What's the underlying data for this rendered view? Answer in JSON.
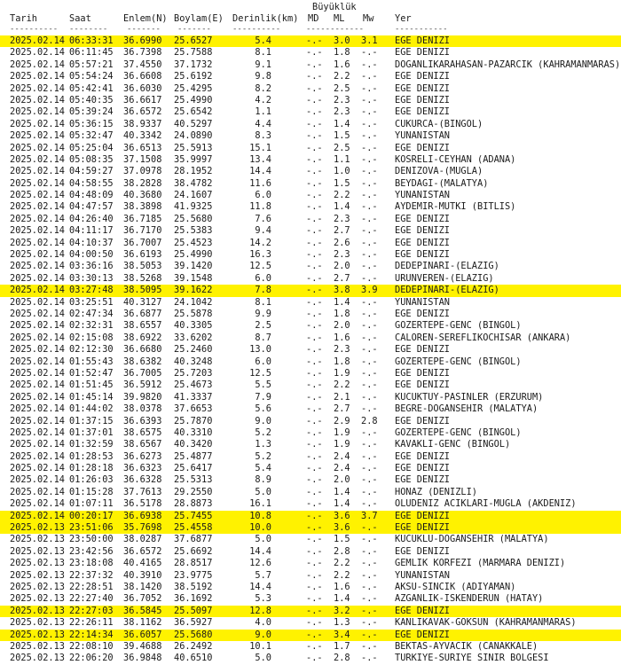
{
  "header": {
    "group_label": "Büyüklük",
    "columns": {
      "tarih": "Tarih",
      "saat": "Saat",
      "enlem": "Enlem(N)",
      "boylam": "Boylam(E)",
      "derinlik": "Derinlik(km)",
      "md": "MD",
      "ml": "ML",
      "mw": "Mw",
      "yer": "Yer"
    },
    "dashes": {
      "tarih": "----------",
      "saat": "--------",
      "enlem": "-------",
      "boylam": "-------",
      "derinlik": "----------",
      "mag": "------------",
      "yer": "-----------"
    }
  },
  "rows": [
    {
      "tarih": "2025.02.14",
      "saat": "06:33:31",
      "enlem": "36.6990",
      "boylam": "25.6527",
      "derinlik": "5.4",
      "md": "-.-",
      "ml": "3.0",
      "mw": "3.1",
      "yer": "EGE DENIZI",
      "hl": true
    },
    {
      "tarih": "2025.02.14",
      "saat": "06:11:45",
      "enlem": "36.7398",
      "boylam": "25.7588",
      "derinlik": "8.1",
      "md": "-.-",
      "ml": "1.8",
      "mw": "-.-",
      "yer": "EGE DENIZI",
      "hl": false
    },
    {
      "tarih": "2025.02.14",
      "saat": "05:57:21",
      "enlem": "37.4550",
      "boylam": "37.1732",
      "derinlik": "9.1",
      "md": "-.-",
      "ml": "1.6",
      "mw": "-.-",
      "yer": "DOGANLIKARAHASAN-PAZARCIK (KAHRAMANMARAS)",
      "hl": false
    },
    {
      "tarih": "2025.02.14",
      "saat": "05:54:24",
      "enlem": "36.6608",
      "boylam": "25.6192",
      "derinlik": "9.8",
      "md": "-.-",
      "ml": "2.2",
      "mw": "-.-",
      "yer": "EGE DENIZI",
      "hl": false
    },
    {
      "tarih": "2025.02.14",
      "saat": "05:42:41",
      "enlem": "36.6030",
      "boylam": "25.4295",
      "derinlik": "8.2",
      "md": "-.-",
      "ml": "2.5",
      "mw": "-.-",
      "yer": "EGE DENIZI",
      "hl": false
    },
    {
      "tarih": "2025.02.14",
      "saat": "05:40:35",
      "enlem": "36.6617",
      "boylam": "25.4990",
      "derinlik": "4.2",
      "md": "-.-",
      "ml": "2.3",
      "mw": "-.-",
      "yer": "EGE DENIZI",
      "hl": false
    },
    {
      "tarih": "2025.02.14",
      "saat": "05:39:24",
      "enlem": "36.6572",
      "boylam": "25.6542",
      "derinlik": "1.1",
      "md": "-.-",
      "ml": "2.3",
      "mw": "-.-",
      "yer": "EGE DENIZI",
      "hl": false
    },
    {
      "tarih": "2025.02.14",
      "saat": "05:36:15",
      "enlem": "38.9337",
      "boylam": "40.5297",
      "derinlik": "4.4",
      "md": "-.-",
      "ml": "1.4",
      "mw": "-.-",
      "yer": "CUKURCA-(BINGOL)",
      "hl": false
    },
    {
      "tarih": "2025.02.14",
      "saat": "05:32:47",
      "enlem": "40.3342",
      "boylam": "24.0890",
      "derinlik": "8.3",
      "md": "-.-",
      "ml": "1.5",
      "mw": "-.-",
      "yer": "YUNANISTAN",
      "hl": false
    },
    {
      "tarih": "2025.02.14",
      "saat": "05:25:04",
      "enlem": "36.6513",
      "boylam": "25.5913",
      "derinlik": "15.1",
      "md": "-.-",
      "ml": "2.5",
      "mw": "-.-",
      "yer": "EGE DENIZI",
      "hl": false
    },
    {
      "tarih": "2025.02.14",
      "saat": "05:08:35",
      "enlem": "37.1508",
      "boylam": "35.9997",
      "derinlik": "13.4",
      "md": "-.-",
      "ml": "1.1",
      "mw": "-.-",
      "yer": "KOSRELI-CEYHAN (ADANA)",
      "hl": false
    },
    {
      "tarih": "2025.02.14",
      "saat": "04:59:27",
      "enlem": "37.0978",
      "boylam": "28.1952",
      "derinlik": "14.4",
      "md": "-.-",
      "ml": "1.0",
      "mw": "-.-",
      "yer": "DENIZOVA-(MUGLA)",
      "hl": false
    },
    {
      "tarih": "2025.02.14",
      "saat": "04:58:55",
      "enlem": "38.2828",
      "boylam": "38.4782",
      "derinlik": "11.6",
      "md": "-.-",
      "ml": "1.5",
      "mw": "-.-",
      "yer": "BEYDAGI-(MALATYA)",
      "hl": false
    },
    {
      "tarih": "2025.02.14",
      "saat": "04:48:09",
      "enlem": "40.3680",
      "boylam": "24.1607",
      "derinlik": "6.0",
      "md": "-.-",
      "ml": "2.2",
      "mw": "-.-",
      "yer": "YUNANISTAN",
      "hl": false
    },
    {
      "tarih": "2025.02.14",
      "saat": "04:47:57",
      "enlem": "38.3898",
      "boylam": "41.9325",
      "derinlik": "11.8",
      "md": "-.-",
      "ml": "1.4",
      "mw": "-.-",
      "yer": "AYDEMIR-MUTKI (BITLIS)",
      "hl": false
    },
    {
      "tarih": "2025.02.14",
      "saat": "04:26:40",
      "enlem": "36.7185",
      "boylam": "25.5680",
      "derinlik": "7.6",
      "md": "-.-",
      "ml": "2.3",
      "mw": "-.-",
      "yer": "EGE DENIZI",
      "hl": false
    },
    {
      "tarih": "2025.02.14",
      "saat": "04:11:17",
      "enlem": "36.7170",
      "boylam": "25.5383",
      "derinlik": "9.4",
      "md": "-.-",
      "ml": "2.7",
      "mw": "-.-",
      "yer": "EGE DENIZI",
      "hl": false
    },
    {
      "tarih": "2025.02.14",
      "saat": "04:10:37",
      "enlem": "36.7007",
      "boylam": "25.4523",
      "derinlik": "14.2",
      "md": "-.-",
      "ml": "2.6",
      "mw": "-.-",
      "yer": "EGE DENIZI",
      "hl": false
    },
    {
      "tarih": "2025.02.14",
      "saat": "04:00:50",
      "enlem": "36.6193",
      "boylam": "25.4990",
      "derinlik": "16.3",
      "md": "-.-",
      "ml": "2.3",
      "mw": "-.-",
      "yer": "EGE DENIZI",
      "hl": false
    },
    {
      "tarih": "2025.02.14",
      "saat": "03:36:16",
      "enlem": "38.5053",
      "boylam": "39.1420",
      "derinlik": "12.5",
      "md": "-.-",
      "ml": "2.0",
      "mw": "-.-",
      "yer": "DEDEPINARI-(ELAZIG)",
      "hl": false
    },
    {
      "tarih": "2025.02.14",
      "saat": "03:30:13",
      "enlem": "38.5268",
      "boylam": "39.1548",
      "derinlik": "6.0",
      "md": "-.-",
      "ml": "2.7",
      "mw": "-.-",
      "yer": "URUNVEREN-(ELAZIG)",
      "hl": false
    },
    {
      "tarih": "2025.02.14",
      "saat": "03:27:48",
      "enlem": "38.5095",
      "boylam": "39.1622",
      "derinlik": "7.8",
      "md": "-.-",
      "ml": "3.8",
      "mw": "3.9",
      "yer": "DEDEPINARI-(ELAZIG)",
      "hl": true
    },
    {
      "tarih": "2025.02.14",
      "saat": "03:25:51",
      "enlem": "40.3127",
      "boylam": "24.1042",
      "derinlik": "8.1",
      "md": "-.-",
      "ml": "1.4",
      "mw": "-.-",
      "yer": "YUNANISTAN",
      "hl": false
    },
    {
      "tarih": "2025.02.14",
      "saat": "02:47:34",
      "enlem": "36.6877",
      "boylam": "25.5878",
      "derinlik": "9.9",
      "md": "-.-",
      "ml": "1.8",
      "mw": "-.-",
      "yer": "EGE DENIZI",
      "hl": false
    },
    {
      "tarih": "2025.02.14",
      "saat": "02:32:31",
      "enlem": "38.6557",
      "boylam": "40.3305",
      "derinlik": "2.5",
      "md": "-.-",
      "ml": "2.0",
      "mw": "-.-",
      "yer": "GOZERTEPE-GENC (BINGOL)",
      "hl": false
    },
    {
      "tarih": "2025.02.14",
      "saat": "02:15:08",
      "enlem": "38.6922",
      "boylam": "33.6202",
      "derinlik": "8.7",
      "md": "-.-",
      "ml": "1.6",
      "mw": "-.-",
      "yer": "CALOREN-SEREFLIKOCHISAR (ANKARA)",
      "hl": false
    },
    {
      "tarih": "2025.02.14",
      "saat": "02:12:30",
      "enlem": "36.6680",
      "boylam": "25.2460",
      "derinlik": "13.0",
      "md": "-.-",
      "ml": "2.3",
      "mw": "-.-",
      "yer": "EGE DENIZI",
      "hl": false
    },
    {
      "tarih": "2025.02.14",
      "saat": "01:55:43",
      "enlem": "38.6382",
      "boylam": "40.3248",
      "derinlik": "6.0",
      "md": "-.-",
      "ml": "1.8",
      "mw": "-.-",
      "yer": "GOZERTEPE-GENC (BINGOL)",
      "hl": false
    },
    {
      "tarih": "2025.02.14",
      "saat": "01:52:47",
      "enlem": "36.7005",
      "boylam": "25.7203",
      "derinlik": "12.5",
      "md": "-.-",
      "ml": "1.9",
      "mw": "-.-",
      "yer": "EGE DENIZI",
      "hl": false
    },
    {
      "tarih": "2025.02.14",
      "saat": "01:51:45",
      "enlem": "36.5912",
      "boylam": "25.4673",
      "derinlik": "5.5",
      "md": "-.-",
      "ml": "2.2",
      "mw": "-.-",
      "yer": "EGE DENIZI",
      "hl": false
    },
    {
      "tarih": "2025.02.14",
      "saat": "01:45:14",
      "enlem": "39.9820",
      "boylam": "41.3337",
      "derinlik": "7.9",
      "md": "-.-",
      "ml": "2.1",
      "mw": "-.-",
      "yer": "KUCUKTUY-PASINLER (ERZURUM)",
      "hl": false
    },
    {
      "tarih": "2025.02.14",
      "saat": "01:44:02",
      "enlem": "38.0378",
      "boylam": "37.6653",
      "derinlik": "5.6",
      "md": "-.-",
      "ml": "2.7",
      "mw": "-.-",
      "yer": "BEGRE-DOGANSEHIR (MALATYA)",
      "hl": false
    },
    {
      "tarih": "2025.02.14",
      "saat": "01:37:15",
      "enlem": "36.6393",
      "boylam": "25.7870",
      "derinlik": "9.0",
      "md": "-.-",
      "ml": "2.9",
      "mw": "2.8",
      "yer": "EGE DENIZI",
      "hl": false
    },
    {
      "tarih": "2025.02.14",
      "saat": "01:37:01",
      "enlem": "38.6575",
      "boylam": "40.3310",
      "derinlik": "5.2",
      "md": "-.-",
      "ml": "1.9",
      "mw": "-.-",
      "yer": "GOZERTEPE-GENC (BINGOL)",
      "hl": false
    },
    {
      "tarih": "2025.02.14",
      "saat": "01:32:59",
      "enlem": "38.6567",
      "boylam": "40.3420",
      "derinlik": "1.3",
      "md": "-.-",
      "ml": "1.9",
      "mw": "-.-",
      "yer": "KAVAKLI-GENC (BINGOL)",
      "hl": false
    },
    {
      "tarih": "2025.02.14",
      "saat": "01:28:53",
      "enlem": "36.6273",
      "boylam": "25.4877",
      "derinlik": "5.2",
      "md": "-.-",
      "ml": "2.4",
      "mw": "-.-",
      "yer": "EGE DENIZI",
      "hl": false
    },
    {
      "tarih": "2025.02.14",
      "saat": "01:28:18",
      "enlem": "36.6323",
      "boylam": "25.6417",
      "derinlik": "5.4",
      "md": "-.-",
      "ml": "2.4",
      "mw": "-.-",
      "yer": "EGE DENIZI",
      "hl": false
    },
    {
      "tarih": "2025.02.14",
      "saat": "01:26:03",
      "enlem": "36.6328",
      "boylam": "25.5313",
      "derinlik": "8.9",
      "md": "-.-",
      "ml": "2.0",
      "mw": "-.-",
      "yer": "EGE DENIZI",
      "hl": false
    },
    {
      "tarih": "2025.02.14",
      "saat": "01:15:28",
      "enlem": "37.7613",
      "boylam": "29.2550",
      "derinlik": "5.0",
      "md": "-.-",
      "ml": "1.4",
      "mw": "-.-",
      "yer": "HONAZ (DENIZLI)",
      "hl": false
    },
    {
      "tarih": "2025.02.14",
      "saat": "01:07:11",
      "enlem": "36.5178",
      "boylam": "28.8873",
      "derinlik": "16.1",
      "md": "-.-",
      "ml": "1.4",
      "mw": "-.-",
      "yer": "OLUDENIZ ACIKLARI-MUGLA (AKDENIZ)",
      "hl": false
    },
    {
      "tarih": "2025.02.14",
      "saat": "00:20:17",
      "enlem": "36.6938",
      "boylam": "25.7455",
      "derinlik": "10.8",
      "md": "-.-",
      "ml": "3.6",
      "mw": "3.7",
      "yer": "EGE DENIZI",
      "hl": true
    },
    {
      "tarih": "2025.02.13",
      "saat": "23:51:06",
      "enlem": "35.7698",
      "boylam": "25.4558",
      "derinlik": "10.0",
      "md": "-.-",
      "ml": "3.6",
      "mw": "-.-",
      "yer": "EGE DENIZI",
      "hl": true
    },
    {
      "tarih": "2025.02.13",
      "saat": "23:50:00",
      "enlem": "38.0287",
      "boylam": "37.6877",
      "derinlik": "5.0",
      "md": "-.-",
      "ml": "1.5",
      "mw": "-.-",
      "yer": "KUCUKLU-DOGANSEHIR (MALATYA)",
      "hl": false
    },
    {
      "tarih": "2025.02.13",
      "saat": "23:42:56",
      "enlem": "36.6572",
      "boylam": "25.6692",
      "derinlik": "14.4",
      "md": "-.-",
      "ml": "2.8",
      "mw": "-.-",
      "yer": "EGE DENIZI",
      "hl": false
    },
    {
      "tarih": "2025.02.13",
      "saat": "23:18:08",
      "enlem": "40.4165",
      "boylam": "28.8517",
      "derinlik": "12.6",
      "md": "-.-",
      "ml": "2.2",
      "mw": "-.-",
      "yer": "GEMLIK KORFEZI (MARMARA DENIZI)",
      "hl": false
    },
    {
      "tarih": "2025.02.13",
      "saat": "22:37:32",
      "enlem": "40.3910",
      "boylam": "23.9775",
      "derinlik": "5.7",
      "md": "-.-",
      "ml": "2.2",
      "mw": "-.-",
      "yer": "YUNANISTAN",
      "hl": false
    },
    {
      "tarih": "2025.02.13",
      "saat": "22:28:51",
      "enlem": "38.1420",
      "boylam": "38.5192",
      "derinlik": "14.4",
      "md": "-.-",
      "ml": "1.6",
      "mw": "-.-",
      "yer": "AKSU-SINCIK (ADIYAMAN)",
      "hl": false
    },
    {
      "tarih": "2025.02.13",
      "saat": "22:27:40",
      "enlem": "36.7052",
      "boylam": "36.1692",
      "derinlik": "5.3",
      "md": "-.-",
      "ml": "1.4",
      "mw": "-.-",
      "yer": "AZGANLIK-ISKENDERUN (HATAY)",
      "hl": false
    },
    {
      "tarih": "2025.02.13",
      "saat": "22:27:03",
      "enlem": "36.5845",
      "boylam": "25.5097",
      "derinlik": "12.8",
      "md": "-.-",
      "ml": "3.2",
      "mw": "-.-",
      "yer": "EGE DENIZI",
      "hl": true
    },
    {
      "tarih": "2025.02.13",
      "saat": "22:26:11",
      "enlem": "38.1162",
      "boylam": "36.5927",
      "derinlik": "4.0",
      "md": "-.-",
      "ml": "1.3",
      "mw": "-.-",
      "yer": "KANLIKAVAK-GOKSUN (KAHRAMANMARAS)",
      "hl": false
    },
    {
      "tarih": "2025.02.13",
      "saat": "22:14:34",
      "enlem": "36.6057",
      "boylam": "25.5680",
      "derinlik": "9.0",
      "md": "-.-",
      "ml": "3.4",
      "mw": "-.-",
      "yer": "EGE DENIZI",
      "hl": true
    },
    {
      "tarih": "2025.02.13",
      "saat": "22:08:10",
      "enlem": "39.4688",
      "boylam": "26.2492",
      "derinlik": "10.1",
      "md": "-.-",
      "ml": "1.7",
      "mw": "-.-",
      "yer": "BEKTAS-AYVACIK (CANAKKALE)",
      "hl": false
    },
    {
      "tarih": "2025.02.13",
      "saat": "22:06:20",
      "enlem": "36.9848",
      "boylam": "40.6510",
      "derinlik": "5.0",
      "md": "-.-",
      "ml": "2.8",
      "mw": "-.-",
      "yer": "TURKIYE-SURIYE SINIR BOLGESI",
      "hl": false
    }
  ]
}
